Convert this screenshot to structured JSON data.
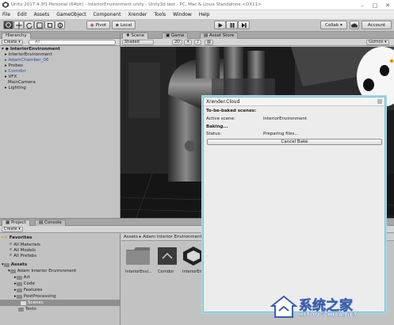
{
  "window": {
    "title": "Unity 2017.4.3f1 Personal (64bit) - InteriorEnvironment.unity - Unity3d test - PC, Mac & Linux Standalone <DX11>",
    "controls": [
      "–",
      "□",
      "✕"
    ]
  },
  "menu": [
    "File",
    "Edit",
    "Assets",
    "GameObject",
    "Component",
    "Xrender",
    "Tools",
    "Window",
    "Help"
  ],
  "toolbar": {
    "pivot_label": "Pivot",
    "local_label": "Local",
    "collab_label": "Collab ▾",
    "account_label": "Account"
  },
  "hierarchy": {
    "tab_label": "Hierarchy",
    "create_label": "Create ▾",
    "search_placeholder": "All",
    "scene_name": "InteriorEnvironment",
    "items": [
      {
        "label": "InteriorEnvironment",
        "color": "#1a1a1a"
      },
      {
        "label": "AdamChamber_06",
        "color": "#2a4fb0"
      },
      {
        "label": "Probes",
        "color": "#1a1a1a"
      },
      {
        "label": "Corridor",
        "color": "#2a4fb0"
      },
      {
        "label": "VFX",
        "color": "#1a1a1a"
      },
      {
        "label": "MainCamera",
        "color": "#1a1a1a"
      },
      {
        "label": "Lighting",
        "color": "#1a1a1a"
      }
    ]
  },
  "scene": {
    "tabs": [
      "Scene",
      "Game",
      "Asset Store"
    ],
    "shading_label": "Shaded",
    "mode_label": "2D",
    "gizmos_label": "Gizmos ▾"
  },
  "project": {
    "tabs": [
      "Project",
      "Console"
    ],
    "create_label": "Create ▾",
    "favorites_label": "Favorites",
    "favorites": [
      "All Materials",
      "All Models",
      "All Prefabs"
    ],
    "assets_label": "Assets",
    "tree": [
      "Adam Interior Environment",
      "Art",
      "Code",
      "Features",
      "PostProcessing",
      "Scenes",
      "Tests"
    ],
    "breadcrumb": "Assets ▸ Adam Interior Environment ▸",
    "files": [
      "InteriorEnvi...",
      "Corridor",
      "InteriorEnvi..."
    ]
  },
  "dialog": {
    "title": "Xrender.Cloud",
    "heading": "To-be-baked scenes:",
    "active_scene_label": "Active scene:",
    "active_scene_value": "InteriorEnvironment",
    "baking_label": "Baking...",
    "status_label": "Status:",
    "status_value": "Preparing files...",
    "cancel_label": "Cancel Bake"
  },
  "watermark": {
    "text": "系统之家",
    "url": "XITONGZHIJIA.NET"
  }
}
